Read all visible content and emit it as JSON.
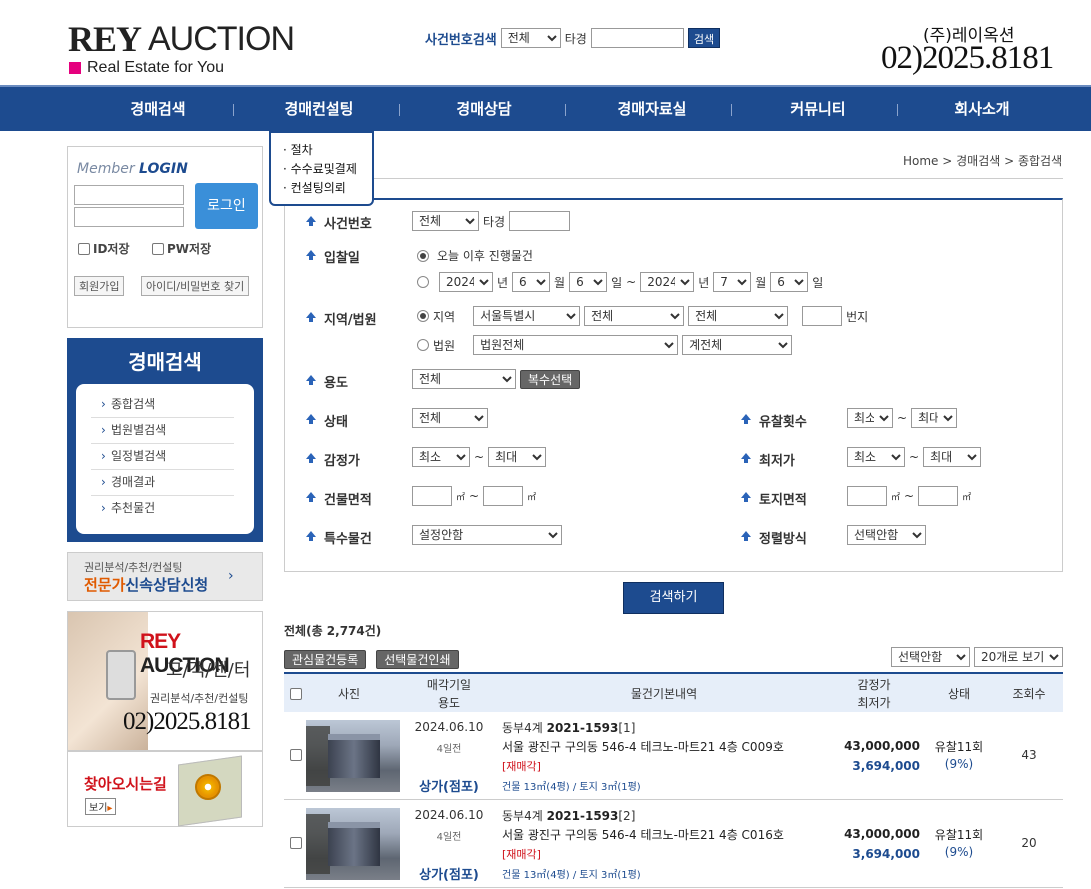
{
  "header": {
    "logo_main": "REY",
    "logo_sub": "AUCTION",
    "tagline": "Real Estate for You",
    "search_label": "사건번호검색",
    "search_select": "전체",
    "search_type_label": "타경",
    "search_button": "검색",
    "company": "(주)레이옥션",
    "phone": "02)2025.8181"
  },
  "nav": {
    "items": [
      "경매검색",
      "경매컨설팅",
      "경매상담",
      "경매자료실",
      "커뮤니티",
      "회사소개"
    ],
    "dropdown": [
      "· 절차",
      "· 수수료및결제",
      "· 컨설팅의뢰"
    ]
  },
  "login": {
    "title_a": "Member",
    "title_b": "LOGIN",
    "button": "로그인",
    "save_id": "ID저장",
    "save_pw": "PW저장",
    "join": "회원가입",
    "find": "아이디/비밀번호 찾기"
  },
  "side_menu": {
    "title": "경매검색",
    "items": [
      "종합검색",
      "법원별검색",
      "일정별검색",
      "경매결과",
      "추천물건"
    ]
  },
  "banners": {
    "consult_small": "권리분석/추천/컨설팅",
    "consult_big_a": "전문가",
    "consult_big_b": "신속상담신청",
    "center_logo_a": "REY",
    "center_logo_b": " AUCTION",
    "center_title": "고/객/센/터",
    "center_sub": "권리분석/추천/컨설팅",
    "center_phone": "02)2025.8181",
    "map_title": "찾아오시는길",
    "map_view": "보기"
  },
  "breadcrumb": "Home > 경매검색 > 종합검색",
  "form": {
    "case_label": "사건번호",
    "case_select": "전체",
    "case_type": "타경",
    "bid_label": "입찰일",
    "bid_opt1": "오늘 이후 진행물건",
    "from_year": "2024",
    "from_month": "6",
    "from_day": "6",
    "to_year": "2024",
    "to_month": "7",
    "to_day": "6",
    "u_year": "년",
    "u_month": "월",
    "u_day": "일",
    "tilde": "~",
    "region_label": "지역/법원",
    "region_opt": "지역",
    "region_sido": "서울특별시",
    "region_gu": "전체",
    "region_dong": "전체",
    "region_bunji": "번지",
    "court_opt": "법원",
    "court_select": "법원전체",
    "court_type": "계전체",
    "usage_label": "용도",
    "usage_select": "전체",
    "multi_btn": "복수선택",
    "state_label": "상태",
    "state_select": "전체",
    "fail_label": "유찰횟수",
    "fail_min": "최소",
    "fail_max": "최대",
    "appraisal_label": "감정가",
    "appr_min": "최소",
    "appr_max": "최대",
    "lowest_label": "최저가",
    "low_min": "최소",
    "low_max": "최대",
    "bldg_label": "건물면적",
    "land_label": "토지면적",
    "unit_m2": "㎡",
    "special_label": "특수물건",
    "special_select": "설정안함",
    "sort_label": "정렬방식",
    "sort_select": "선택안함"
  },
  "search_button": "검색하기",
  "results": {
    "total": "전체(총 2,774건)",
    "btn_fav": "관심물건등록",
    "btn_print": "선택물건인쇄",
    "sort": "선택안함",
    "per_page": "20개로 보기",
    "headers": {
      "photo": "사진",
      "date": "매각기일",
      "usage": "용도",
      "info": "물건기본내역",
      "appraisal": "감정가",
      "lowest": "최저가",
      "state": "상태",
      "views": "조회수"
    },
    "rows": [
      {
        "date": "2024.06.10",
        "dday": "4일전",
        "usage": "상가(점포)",
        "court": "동부4계",
        "case_no": "2021-1593",
        "item_no": "[1]",
        "address": "서울 광진구 구의동 546-4 테크노-마트21 4층 C009호",
        "re": "[재매각]",
        "size": "건물 13㎡(4평) / 토지 3㎡(1평)",
        "appraisal": "43,000,000",
        "lowest": "3,694,000",
        "state": "유찰11회",
        "pct": "(9%)",
        "views": "43"
      },
      {
        "date": "2024.06.10",
        "dday": "4일전",
        "usage": "상가(점포)",
        "court": "동부4계",
        "case_no": "2021-1593",
        "item_no": "[2]",
        "address": "서울 광진구 구의동 546-4 테크노-마트21 4층 C016호",
        "re": "[재매각]",
        "size": "건물 13㎡(4평) / 토지 3㎡(1평)",
        "appraisal": "43,000,000",
        "lowest": "3,694,000",
        "state": "유찰11회",
        "pct": "(9%)",
        "views": "20"
      }
    ]
  }
}
